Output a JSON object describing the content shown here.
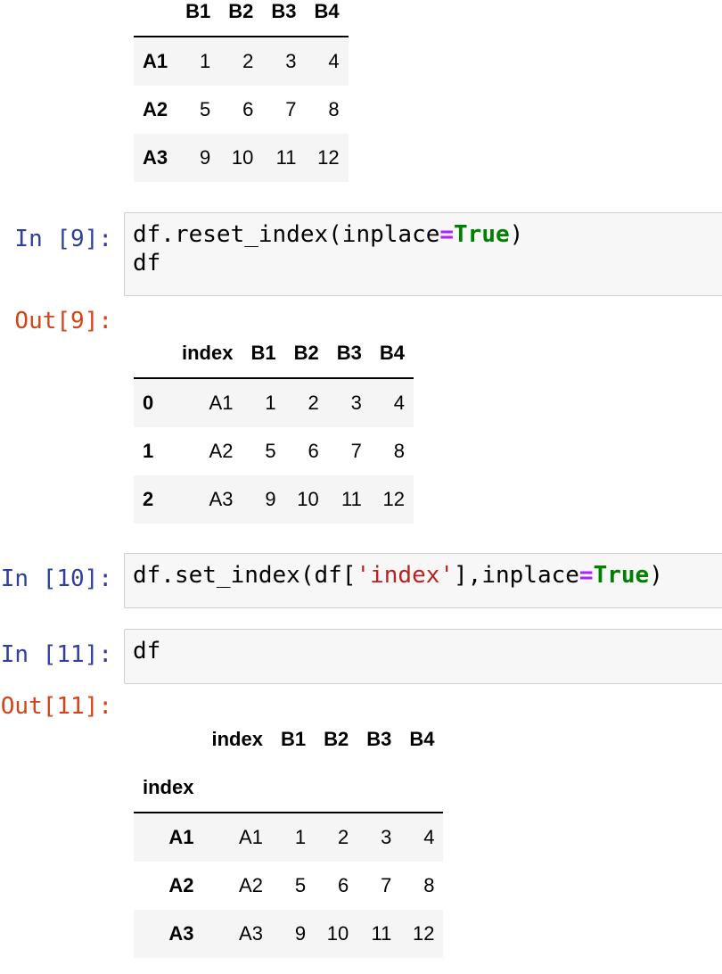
{
  "table_top": {
    "columns": [
      "B1",
      "B2",
      "B3",
      "B4"
    ],
    "rows": [
      {
        "index": "A1",
        "values": [
          "1",
          "2",
          "3",
          "4"
        ]
      },
      {
        "index": "A2",
        "values": [
          "5",
          "6",
          "7",
          "8"
        ]
      },
      {
        "index": "A3",
        "values": [
          "9",
          "10",
          "11",
          "12"
        ]
      }
    ]
  },
  "cell_9": {
    "in_prompt": "In [9]:",
    "out_prompt": "Out[9]:",
    "code_line1_a": "df.reset_index(inplace",
    "code_line1_op": "=",
    "code_line1_kw": "True",
    "code_line1_b": ")",
    "code_line2": "df"
  },
  "table_9": {
    "columns": [
      "index",
      "B1",
      "B2",
      "B3",
      "B4"
    ],
    "rows": [
      {
        "index": "0",
        "values": [
          "A1",
          "1",
          "2",
          "3",
          "4"
        ]
      },
      {
        "index": "1",
        "values": [
          "A2",
          "5",
          "6",
          "7",
          "8"
        ]
      },
      {
        "index": "2",
        "values": [
          "A3",
          "9",
          "10",
          "11",
          "12"
        ]
      }
    ]
  },
  "cell_10": {
    "in_prompt": "In [10]:",
    "code_a": "df.set_index(df[",
    "code_str": "'index'",
    "code_b": "],inplace",
    "code_op": "=",
    "code_kw": "True",
    "code_c": ")"
  },
  "cell_11": {
    "in_prompt": "In [11]:",
    "out_prompt": "Out[11]:",
    "code": "df"
  },
  "table_11": {
    "columns": [
      "index",
      "B1",
      "B2",
      "B3",
      "B4"
    ],
    "index_name": "index",
    "rows": [
      {
        "index": "A1",
        "values": [
          "A1",
          "1",
          "2",
          "3",
          "4"
        ]
      },
      {
        "index": "A2",
        "values": [
          "A2",
          "5",
          "6",
          "7",
          "8"
        ]
      },
      {
        "index": "A3",
        "values": [
          "A3",
          "9",
          "10",
          "11",
          "12"
        ]
      }
    ]
  }
}
